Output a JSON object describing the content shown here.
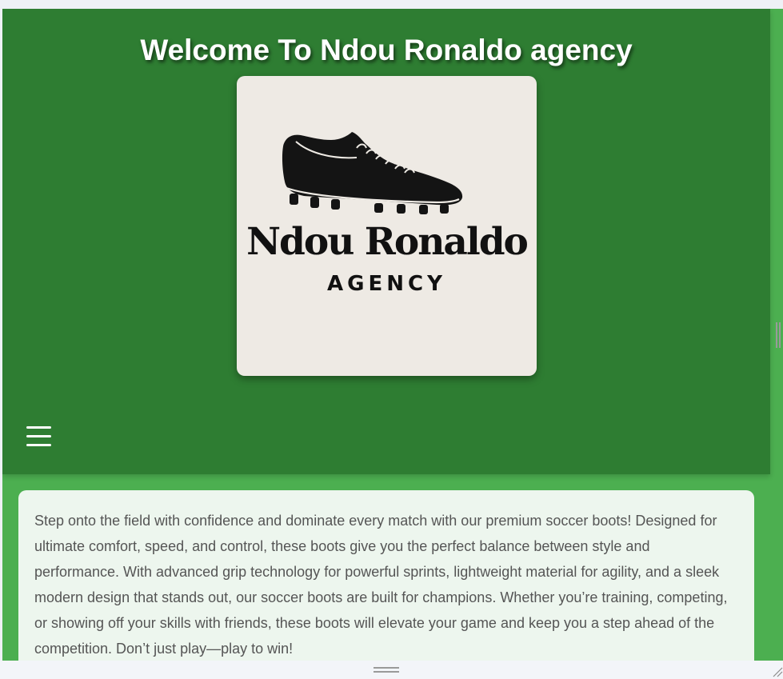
{
  "header": {
    "title": "Welcome To Ndou Ronaldo agency",
    "background_color": "#2e7d32"
  },
  "logo": {
    "name": "Ndou Ronaldo",
    "subtitle": "AGENCY",
    "icon": "soccer-boot-icon",
    "card_color": "#eeeae4"
  },
  "nav": {
    "menu_icon": "hamburger-menu-icon"
  },
  "main": {
    "background_color": "#4caf50",
    "description": "Step onto the field with confidence and dominate every match with our premium soccer boots! Designed for ultimate comfort, speed, and control, these boots give you the perfect balance between style and performance. With advanced grip technology for powerful sprints, lightweight material for agility, and a sleek modern design that stands out, our soccer boots are built for champions. Whether you’re training, competing, or showing off your skills with friends, these boots will elevate your game and keep you a step ahead of the competition. Don’t just play—play to win!"
  }
}
